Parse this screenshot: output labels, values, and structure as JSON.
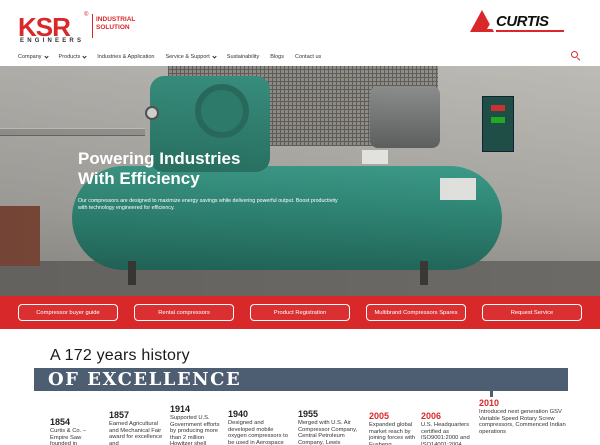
{
  "header": {
    "logo_main": "KSR",
    "logo_reg": "®",
    "logo_sub": "ENGINEERS",
    "logo_tagline": "INDUSTRIAL SOLUTION",
    "partner_logo": "CURTIS"
  },
  "nav": {
    "items": [
      {
        "label": "Company",
        "dropdown": true
      },
      {
        "label": "Products",
        "dropdown": true
      },
      {
        "label": "Industries & Application",
        "dropdown": false
      },
      {
        "label": "Service & Support",
        "dropdown": true
      },
      {
        "label": "Sustainability",
        "dropdown": false
      },
      {
        "label": "Blogs",
        "dropdown": false
      },
      {
        "label": "Contact us",
        "dropdown": false
      }
    ],
    "search_icon": "search-icon"
  },
  "hero": {
    "title_line1": "Powering Industries",
    "title_line2": "With Efficiency",
    "description": "Our compressors are designed to maximize energy savings while delivering powerful output. Boost productivity with technology engineered for efficiency."
  },
  "action_bar": {
    "buttons": [
      "Compressor buyer guide",
      "Rental compressors",
      "Product Registration",
      "Multibrand Compressors Spares",
      "Request Service"
    ]
  },
  "history": {
    "title": "A 172 years history",
    "banner": "OF EXCELLENCE",
    "timeline": [
      {
        "year": "1854",
        "text": "Curtis & Co. – Empire Saw founded in",
        "red": false
      },
      {
        "year": "1857",
        "text": "Earned Agricultural and Mechanical Fair award for excellence and",
        "red": false
      },
      {
        "year": "1914",
        "text": "Supported U.S. Government efforts by producing more than 2 million Howitzer shell",
        "red": false
      },
      {
        "year": "1940",
        "text": "Designed and developed mobile oxygen compressors to be used in Aerospace",
        "red": false
      },
      {
        "year": "1955",
        "text": "Merged with U.S. Air Compressor Company, Central Petroleum Company, Lewis",
        "red": false
      },
      {
        "year": "2005",
        "text": "Expanded global market reach by joining forces with Fusheng",
        "red": true
      },
      {
        "year": "2006",
        "text": "U.S. Headquarters certified as ISO9001:2000 and ISO14001:2004",
        "red": true
      },
      {
        "year": "2010",
        "text": "Introduced next generation GSV Variable Speed Rotary Screw compressors, Commenced Indian operations",
        "red": true
      }
    ]
  },
  "colors": {
    "brand_red": "#d9282a",
    "banner_slate": "#4d5e72"
  }
}
